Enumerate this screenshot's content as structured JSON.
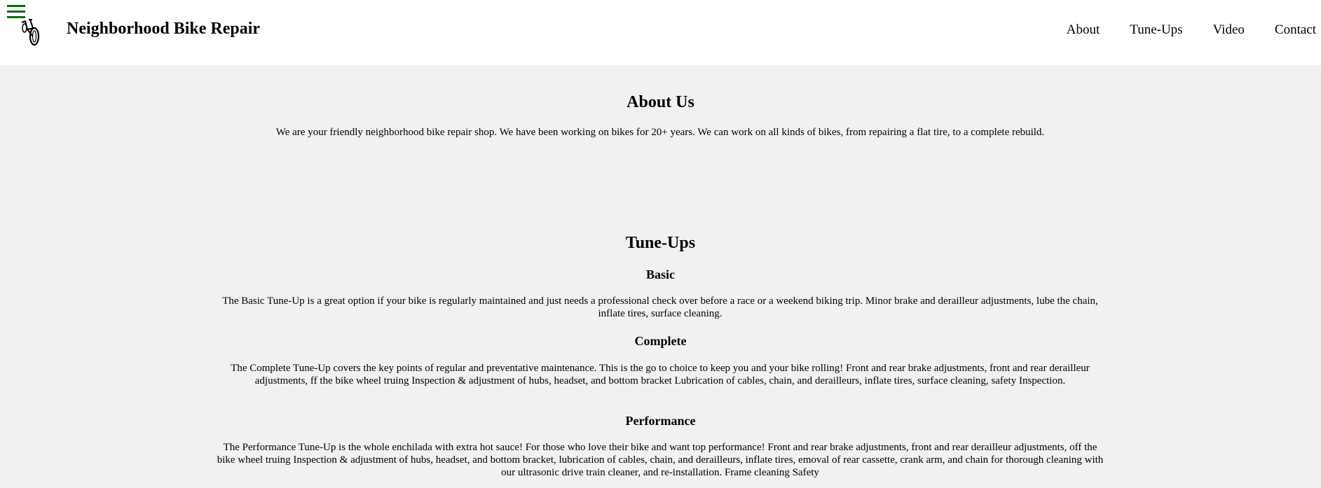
{
  "header": {
    "menu_icon": "hamburger-icon",
    "logo_icon": "bicycle-icon",
    "site_title": "Neighborhood Bike Repair",
    "accent_color": "#0a6b16",
    "nav": [
      {
        "label": "About"
      },
      {
        "label": "Tune-Ups"
      },
      {
        "label": "Video"
      },
      {
        "label": "Contact"
      }
    ]
  },
  "about": {
    "heading": "About Us",
    "text": "We are your friendly neighborhood bike repair shop. We have been working on bikes for 20+ years. We can work on all kinds of bikes, from repairing a flat tire, to a complete rebuild."
  },
  "tuneups": {
    "heading": "Tune-Ups",
    "basic": {
      "heading": "Basic",
      "text": "The Basic Tune-Up is a great option if your bike is regularly maintained and just needs a professional check over before a race or a weekend biking trip. Minor brake and derailleur adjustments, lube the chain, inflate tires, surface cleaning."
    },
    "complete": {
      "heading": "Complete",
      "text": "The Complete Tune-Up covers the key points of regular and preventative maintenance. This is the go to choice to keep you and your bike rolling! Front and rear brake adjustments, front and rear derailleur adjustments, ff the bike wheel truing Inspection & adjustment of hubs, headset, and bottom bracket Lubrication of cables, chain, and derailleurs, inflate tires, surface cleaning, safety Inspection."
    },
    "performance": {
      "heading": "Performance",
      "text": "The Performance Tune-Up is the whole enchilada with extra hot sauce! For those who love their bike and want top performance! Front and rear brake adjustments, front and rear derailleur adjustments, off the bike wheel truing Inspection & adjustment of hubs, headset, and bottom bracket, lubrication of cables, chain, and derailleurs, inflate tires, emoval of rear cassette, crank arm, and chain for thorough cleaning with our ultrasonic drive train cleaner, and re-installation. Frame cleaning Safety"
    }
  }
}
